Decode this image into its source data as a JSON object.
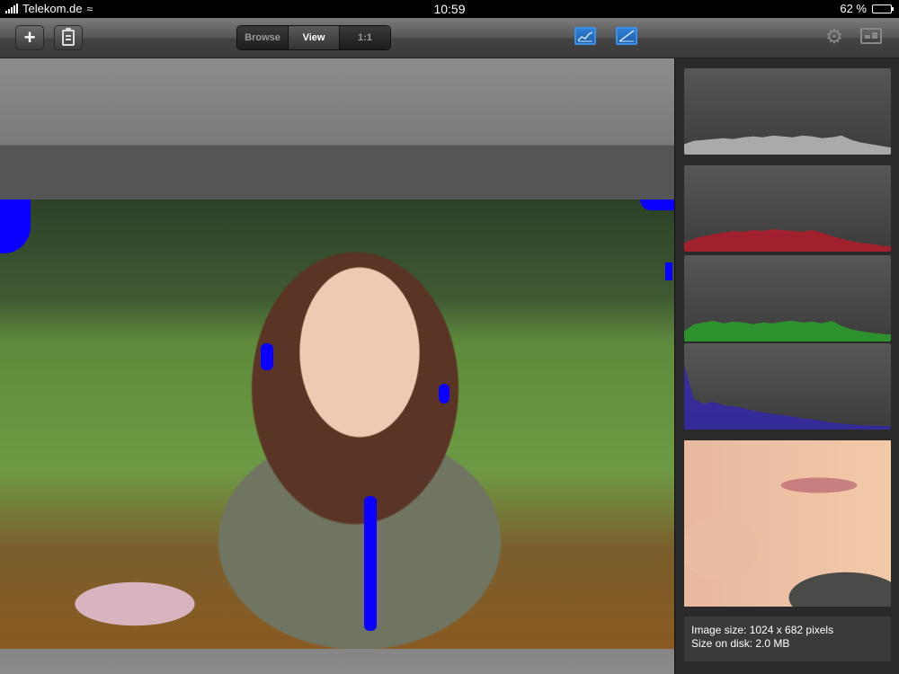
{
  "status_bar": {
    "carrier": "Telekom.de",
    "time": "10:59",
    "battery_percent": "62 %",
    "battery_level": 0.62
  },
  "toolbar": {
    "add_label": "+",
    "mode_tabs": [
      {
        "label": "Browse",
        "active": false
      },
      {
        "label": "View",
        "active": true
      },
      {
        "label": "1:1",
        "active": false
      }
    ],
    "icons": {
      "add": "plus-icon",
      "clipboard": "clipboard-icon",
      "histogram_toggle": "histogram-icon",
      "overlay_toggle": "clipping-overlay-icon",
      "settings": "gear-icon",
      "compare": "compare-icon"
    },
    "accent_color": "#2f7fd6"
  },
  "histograms": [
    {
      "channel": "luminance",
      "color": "#bdbdbd",
      "levels": [
        0.12,
        0.16,
        0.17,
        0.18,
        0.19,
        0.18,
        0.2,
        0.21,
        0.2,
        0.22,
        0.21,
        0.2,
        0.22,
        0.21,
        0.19,
        0.2,
        0.22,
        0.17,
        0.14,
        0.12,
        0.1,
        0.08
      ]
    },
    {
      "channel": "red",
      "color": "#b31b2a",
      "levels": [
        0.1,
        0.15,
        0.18,
        0.2,
        0.22,
        0.24,
        0.23,
        0.25,
        0.24,
        0.26,
        0.25,
        0.24,
        0.23,
        0.25,
        0.22,
        0.18,
        0.15,
        0.12,
        0.1,
        0.09,
        0.07,
        0.06
      ]
    },
    {
      "channel": "green",
      "color": "#2aa12a",
      "levels": [
        0.12,
        0.2,
        0.22,
        0.24,
        0.21,
        0.23,
        0.22,
        0.2,
        0.22,
        0.21,
        0.23,
        0.24,
        0.22,
        0.23,
        0.21,
        0.24,
        0.18,
        0.14,
        0.12,
        0.1,
        0.09,
        0.08
      ]
    },
    {
      "channel": "blue",
      "color": "#3328a8",
      "levels": [
        0.75,
        0.35,
        0.3,
        0.32,
        0.28,
        0.27,
        0.25,
        0.22,
        0.2,
        0.18,
        0.17,
        0.15,
        0.13,
        0.12,
        0.1,
        0.08,
        0.07,
        0.06,
        0.05,
        0.05,
        0.04,
        0.04
      ]
    }
  ],
  "overlay_color": "#0b00ff",
  "info": {
    "image_size": "Image size: 1024 x 682 pixels",
    "disk_size": "Size on disk: 2.0 MB"
  }
}
